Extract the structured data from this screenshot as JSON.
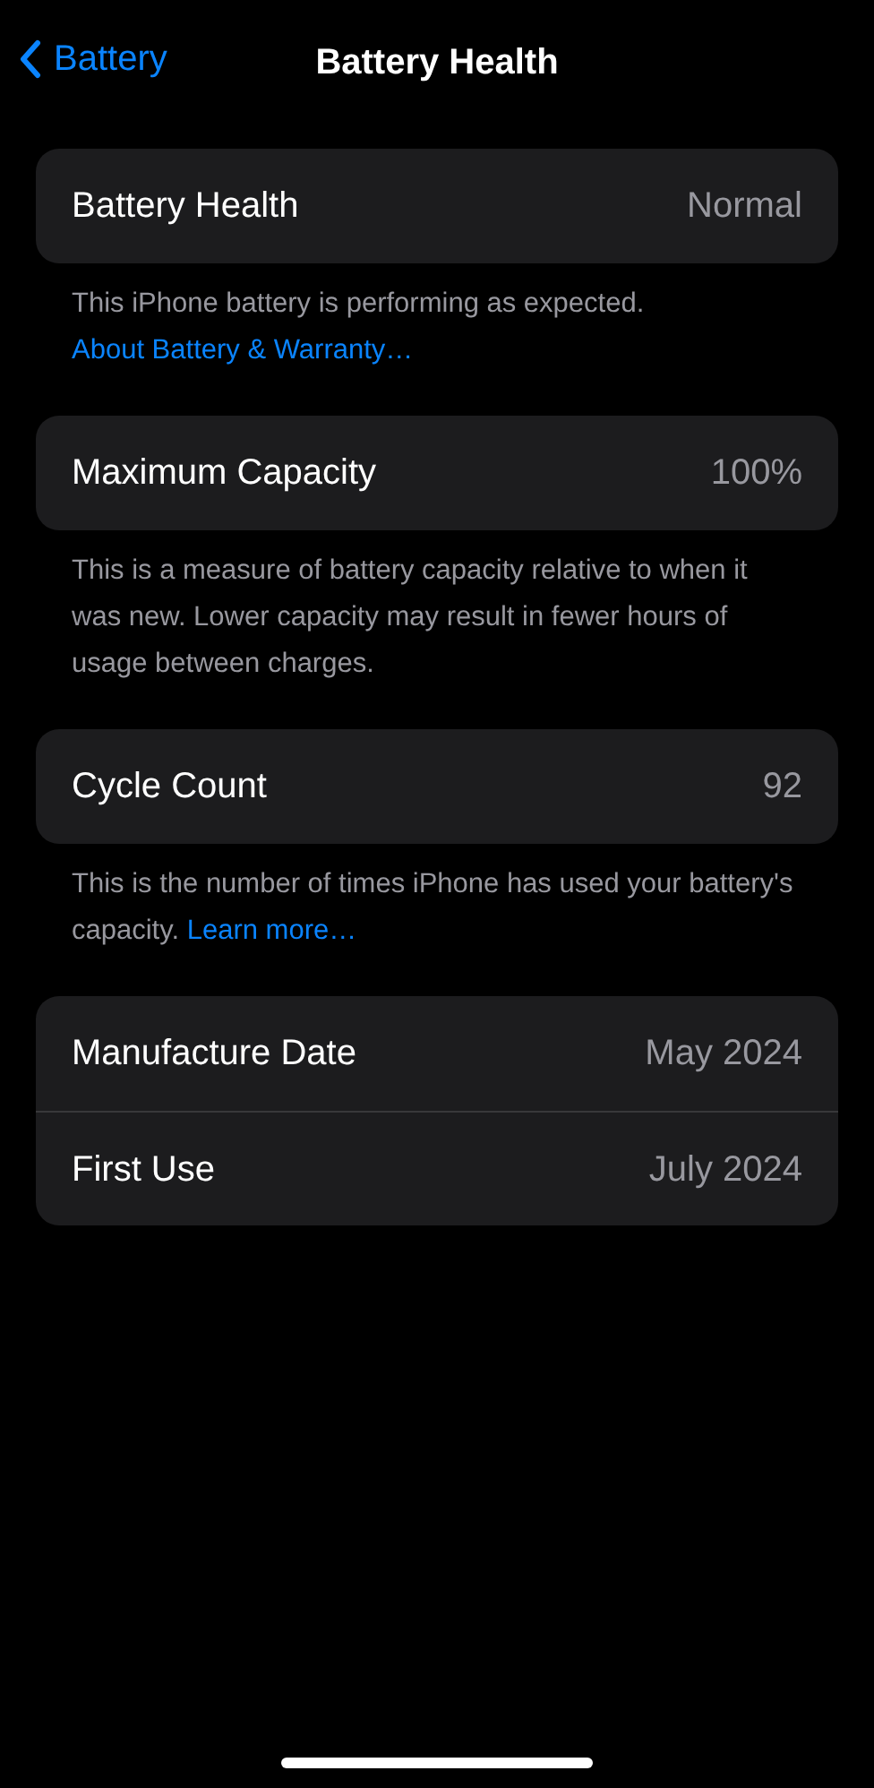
{
  "nav": {
    "back_label": "Battery",
    "title": "Battery Health"
  },
  "sections": [
    {
      "rows": [
        {
          "label": "Battery Health",
          "value": "Normal"
        }
      ],
      "footer": "This iPhone battery is performing as expected.",
      "footer_link": "About Battery & Warranty…"
    },
    {
      "rows": [
        {
          "label": "Maximum Capacity",
          "value": "100%"
        }
      ],
      "footer": "This is a measure of battery capacity relative to when it was new. Lower capacity may result in fewer hours of usage between charges."
    },
    {
      "rows": [
        {
          "label": "Cycle Count",
          "value": "92"
        }
      ],
      "footer": "This is the number of times iPhone has used your battery's capacity.",
      "footer_link": "Learn more…"
    },
    {
      "rows": [
        {
          "label": "Manufacture Date",
          "value": "May 2024"
        },
        {
          "label": "First Use",
          "value": "July 2024"
        }
      ]
    }
  ]
}
